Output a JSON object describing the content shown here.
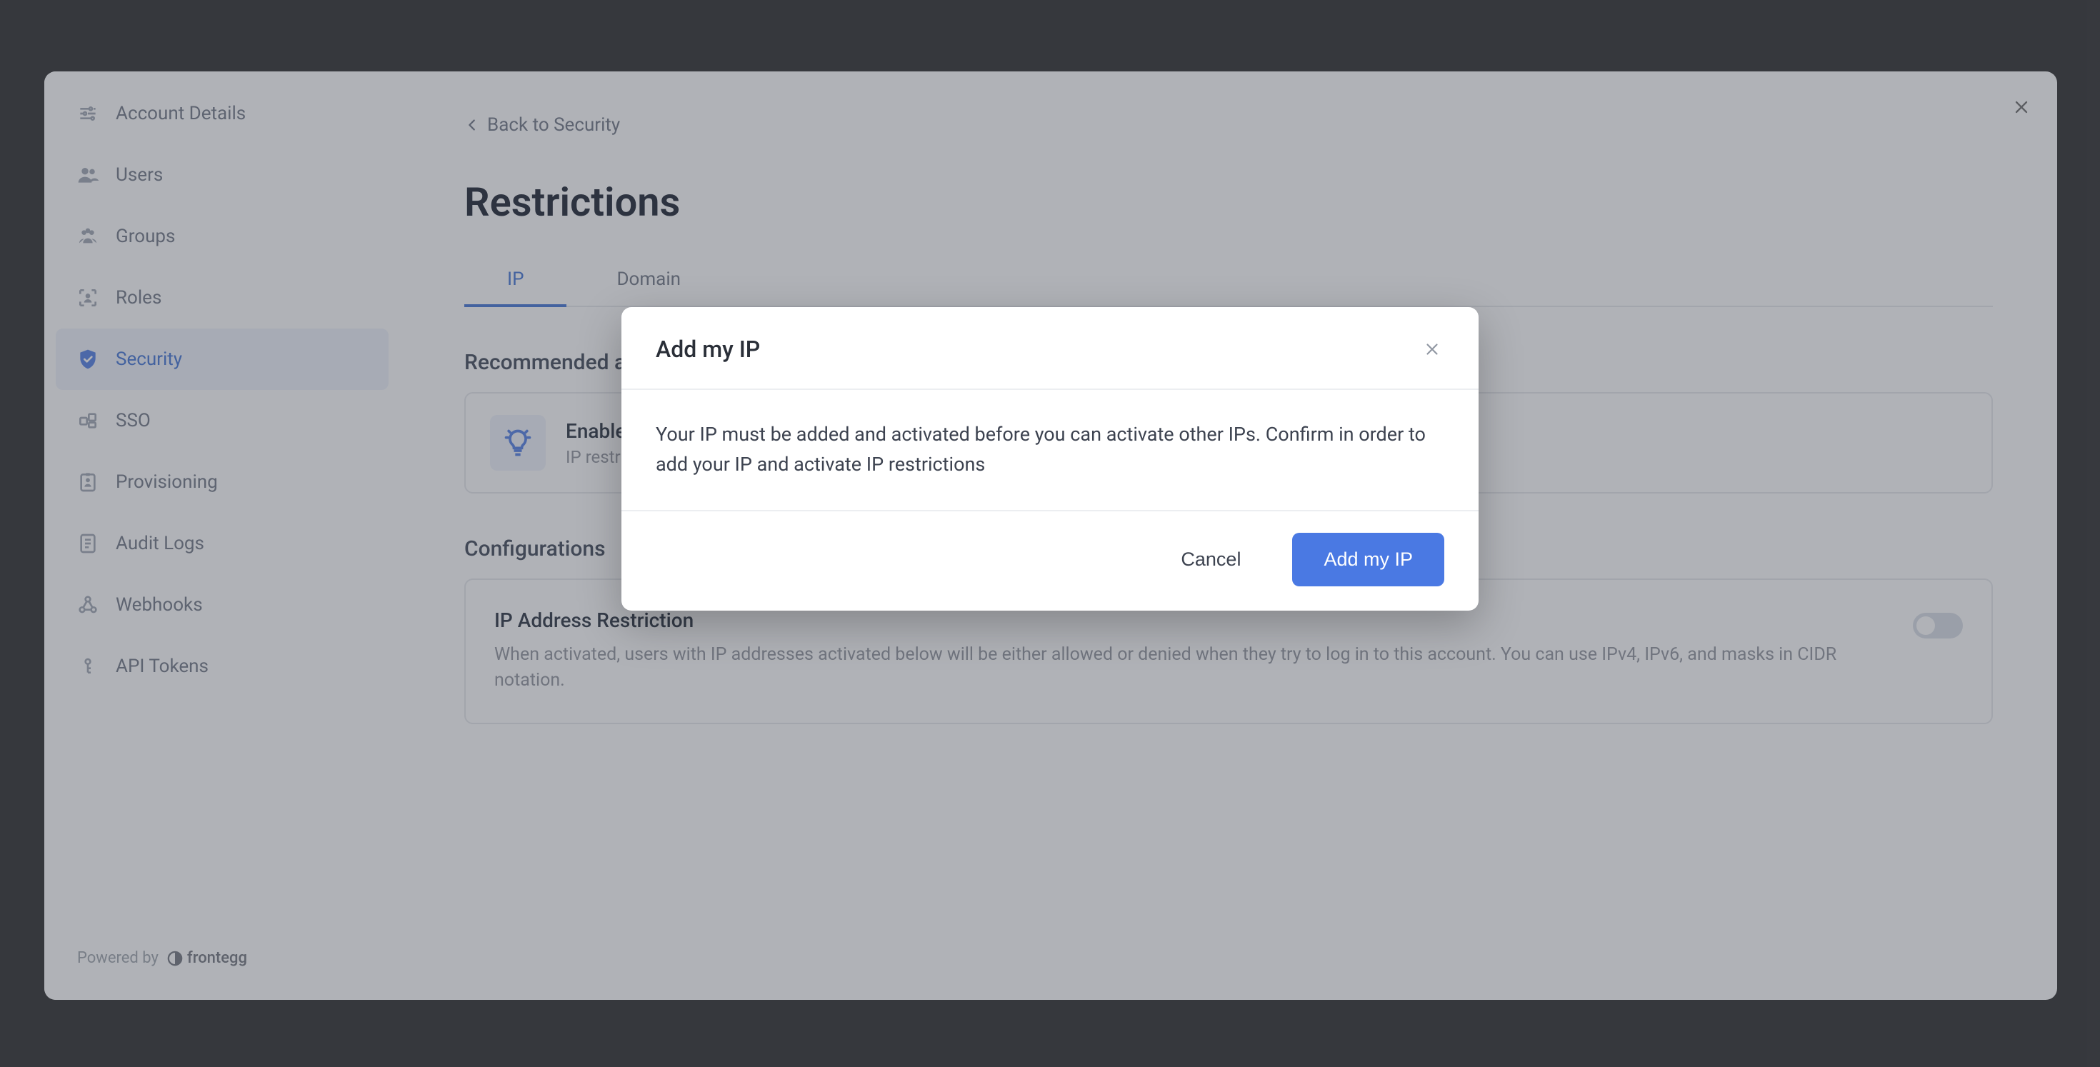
{
  "sidebar": {
    "items": [
      {
        "label": "Account Details"
      },
      {
        "label": "Users"
      },
      {
        "label": "Groups"
      },
      {
        "label": "Roles"
      },
      {
        "label": "Security"
      },
      {
        "label": "SSO"
      },
      {
        "label": "Provisioning"
      },
      {
        "label": "Audit Logs"
      },
      {
        "label": "Webhooks"
      },
      {
        "label": "API Tokens"
      }
    ],
    "active_index": 4,
    "footer": {
      "powered": "Powered by",
      "brand": "frontegg"
    }
  },
  "content": {
    "back_label": "Back to Security",
    "page_title": "Restrictions",
    "tabs": [
      {
        "label": "IP"
      },
      {
        "label": "Domain"
      }
    ],
    "active_tab_index": 0,
    "recommended_title": "Recommended actions",
    "recommended_card": {
      "title": "Enable IP restrictions",
      "subtitle": "IP restrictions are currently disabled"
    },
    "config_title": "Configurations",
    "config_card": {
      "title": "IP Address Restriction",
      "description": "When activated, users with IP addresses activated below will be either allowed or denied when they try to log in to this account. You can use IPv4, IPv6, and masks in CIDR notation.",
      "toggle_on": false
    }
  },
  "modal": {
    "title": "Add my IP",
    "body": "Your IP must be added and activated before you can activate other IPs. Confirm in order to add your IP and activate IP restrictions",
    "cancel": "Cancel",
    "confirm": "Add my IP"
  },
  "colors": {
    "accent": "#4a79e3",
    "sidebar_active_bg": "#eef3fb",
    "text_muted": "#8d919a"
  }
}
